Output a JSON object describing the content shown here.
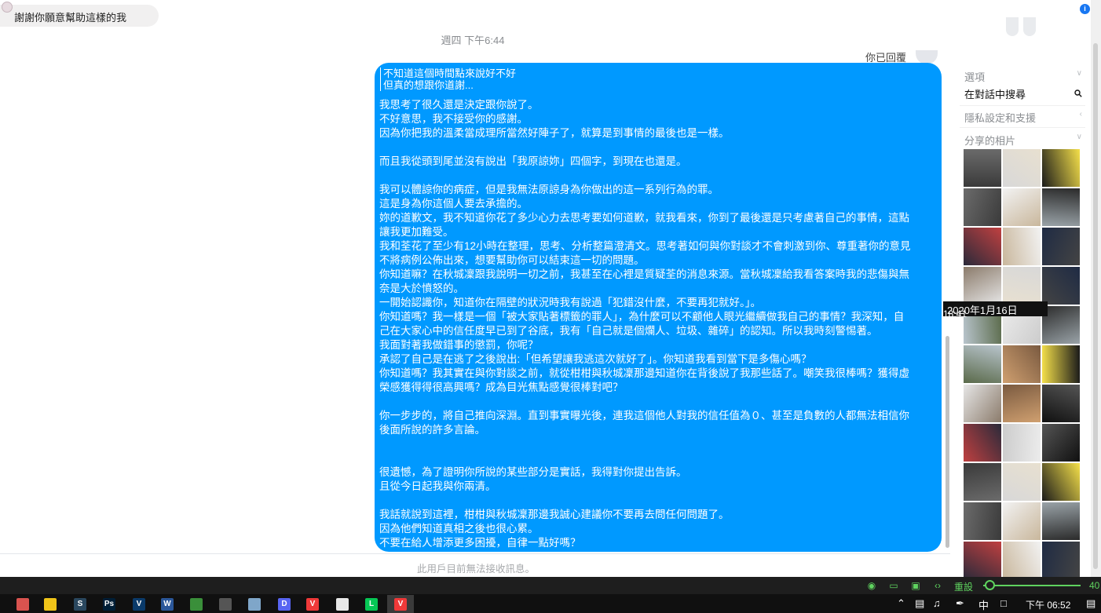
{
  "chat": {
    "previous_message": "謝謝你願意幫助這樣的我",
    "timestamp": "週四 下午6:44",
    "replied_label": "你已回覆",
    "quote_lines": [
      "不知道這個時間點來說好不好",
      "但真的想跟你道謝..."
    ],
    "message_lines": [
      "我思考了很久還是決定跟你說了。",
      "不好意思，我不接受你的感謝。",
      "因為你把我的溫柔當成理所當然好陣子了，就算是到事情的最後也是一樣。",
      "",
      "而且我從頭到尾並沒有說出「我原諒妳」四個字，到現在也還是。",
      "",
      "我可以體諒你的病症，但是我無法原諒身為你做出的這一系列行為的罪。",
      "這是身為你這個人要去承擔的。",
      "妳的道歉文，我不知道你花了多少心力去思考要如何道歉，就我看來，你到了最後還是只考慮著自己的事情，這點",
      "讓我更加難受。",
      "我和荃花了至少有12小時在整理，思考、分析整篇澄清文。思考著如何與你對談才不會刺激到你、尊重著你的意見",
      "不將病例公佈出來，想要幫助你可以結束這一切的問題。",
      "你知道嘛？在秋城凜跟我說明一切之前，我甚至在心裡是質疑荃的消息來源。當秋城凜給我看答案時我的悲傷與無",
      "奈是大於憤怒的。",
      "一開始認識你，知道你在隔壁的狀況時我有說過「犯錯沒什麼，不要再犯就好。」。",
      "你知道嗎？我一樣是一個「被大家貼著標籤的罪人」，為什麼可以不顧他人眼光繼續做我自己的事情？我深知，自",
      "己在大家心中的信任度早已到了谷底，我有「自己就是個爛人、垃圾、雜碎」的認知。所以我時刻警惕著。",
      "我面對著我做錯事的懲罰，你呢？",
      "承認了自己是在逃了之後說出:「但希望讓我逃這次就好了」。你知道我看到當下是多傷心嗎？",
      "你知道嗎？我其實在與你對談之前，就從柑柑與秋城凜那邊知道你在背後說了我那些話了。嘲笑我很棒嗎？獲得虛",
      "榮感獲得得很高興嗎？成為目光焦點感覺很棒對吧？",
      "",
      "你一步步的，將自己推向深淵。直到事實曝光後，連我這個他人對我的信任值為０、甚至是負數的人都無法相信你",
      "後面所說的許多言論。",
      "",
      "",
      "很遺憾，為了證明你所說的某些部分是實話，我得對你提出告訴。",
      "且從今日起我與你兩清。",
      "",
      "我話就說到這裡，柑柑與秋城凜那邊我誠心建議你不要再去問任何問題了。",
      "因為他們知道真相之後也很心累。",
      "不要在給人增添更多困擾，自律一點好嗎？"
    ],
    "unavailable_notice": "此用戶目前無法接收訊息。"
  },
  "panel": {
    "options_label": "選項",
    "search_label": "在對話中搜尋",
    "privacy_label": "隱私設定和支援",
    "shared_photos_label": "分享的相片",
    "tooltip_date": "2020年1月16日",
    "tooltip_time": "18:41"
  },
  "statusbar": {
    "zoom_label": "重設",
    "zoom_value": "40"
  },
  "taskbar": {
    "apps": [
      {
        "name": "app-1",
        "glyph": "",
        "color": "#d9534f"
      },
      {
        "name": "file-explorer",
        "glyph": "",
        "color": "#f0c419"
      },
      {
        "name": "steam",
        "glyph": "S",
        "color": "#2a475e"
      },
      {
        "name": "photoshop",
        "glyph": "Ps",
        "color": "#001e36"
      },
      {
        "name": "vegas",
        "glyph": "V",
        "color": "#0a3a6a"
      },
      {
        "name": "word",
        "glyph": "W",
        "color": "#2b579a"
      },
      {
        "name": "app-7",
        "glyph": "",
        "color": "#3a8f3a"
      },
      {
        "name": "app-8",
        "glyph": "",
        "color": "#555555"
      },
      {
        "name": "notepad",
        "glyph": "",
        "color": "#7fa6c9"
      },
      {
        "name": "discord",
        "glyph": "D",
        "color": "#5865f2"
      },
      {
        "name": "vivaldi-1",
        "glyph": "V",
        "color": "#ef3939"
      },
      {
        "name": "app-12",
        "glyph": "",
        "color": "#e8e8e8"
      },
      {
        "name": "line",
        "glyph": "L",
        "color": "#06c755"
      },
      {
        "name": "vivaldi-2",
        "glyph": "V",
        "color": "#ef3939"
      }
    ],
    "ime": "中",
    "clock": "下午 06:52"
  }
}
